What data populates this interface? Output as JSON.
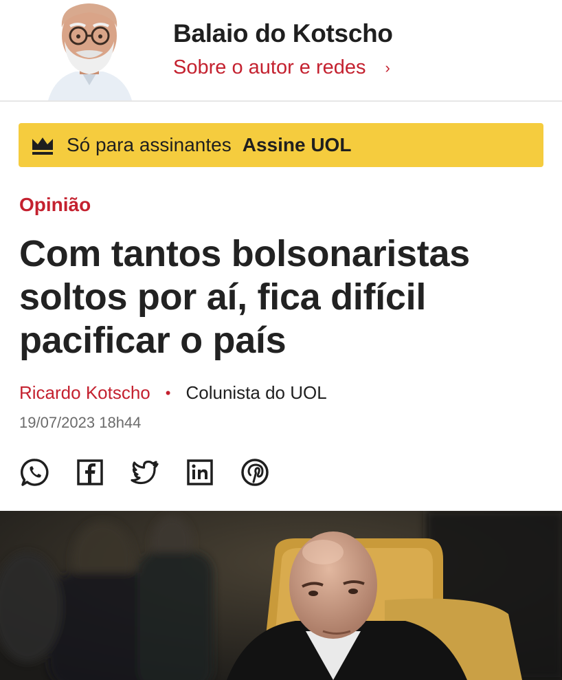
{
  "header": {
    "column_title": "Balaio do Kotscho",
    "author_link": "Sobre o autor e redes",
    "chevron_icon": "chevron-right-icon"
  },
  "subscriber_banner": {
    "icon": "crown-icon",
    "text": "Só para assinantes",
    "cta": "Assine UOL",
    "background_color": "#f5cc3e"
  },
  "article": {
    "category": "Opinião",
    "headline": "Com tantos bolsonaristas soltos por aí, fica difícil pacificar o país",
    "author": "Ricardo Kotscho",
    "separator": "•",
    "role": "Colunista do UOL",
    "date": "19/07/2023 18h44"
  },
  "share_icons": [
    "whatsapp-icon",
    "facebook-icon",
    "twitter-icon",
    "linkedin-icon",
    "pinterest-icon"
  ],
  "colors": {
    "accent": "#c4212f",
    "text": "#1f1f1f",
    "muted": "#6b6b6b"
  }
}
